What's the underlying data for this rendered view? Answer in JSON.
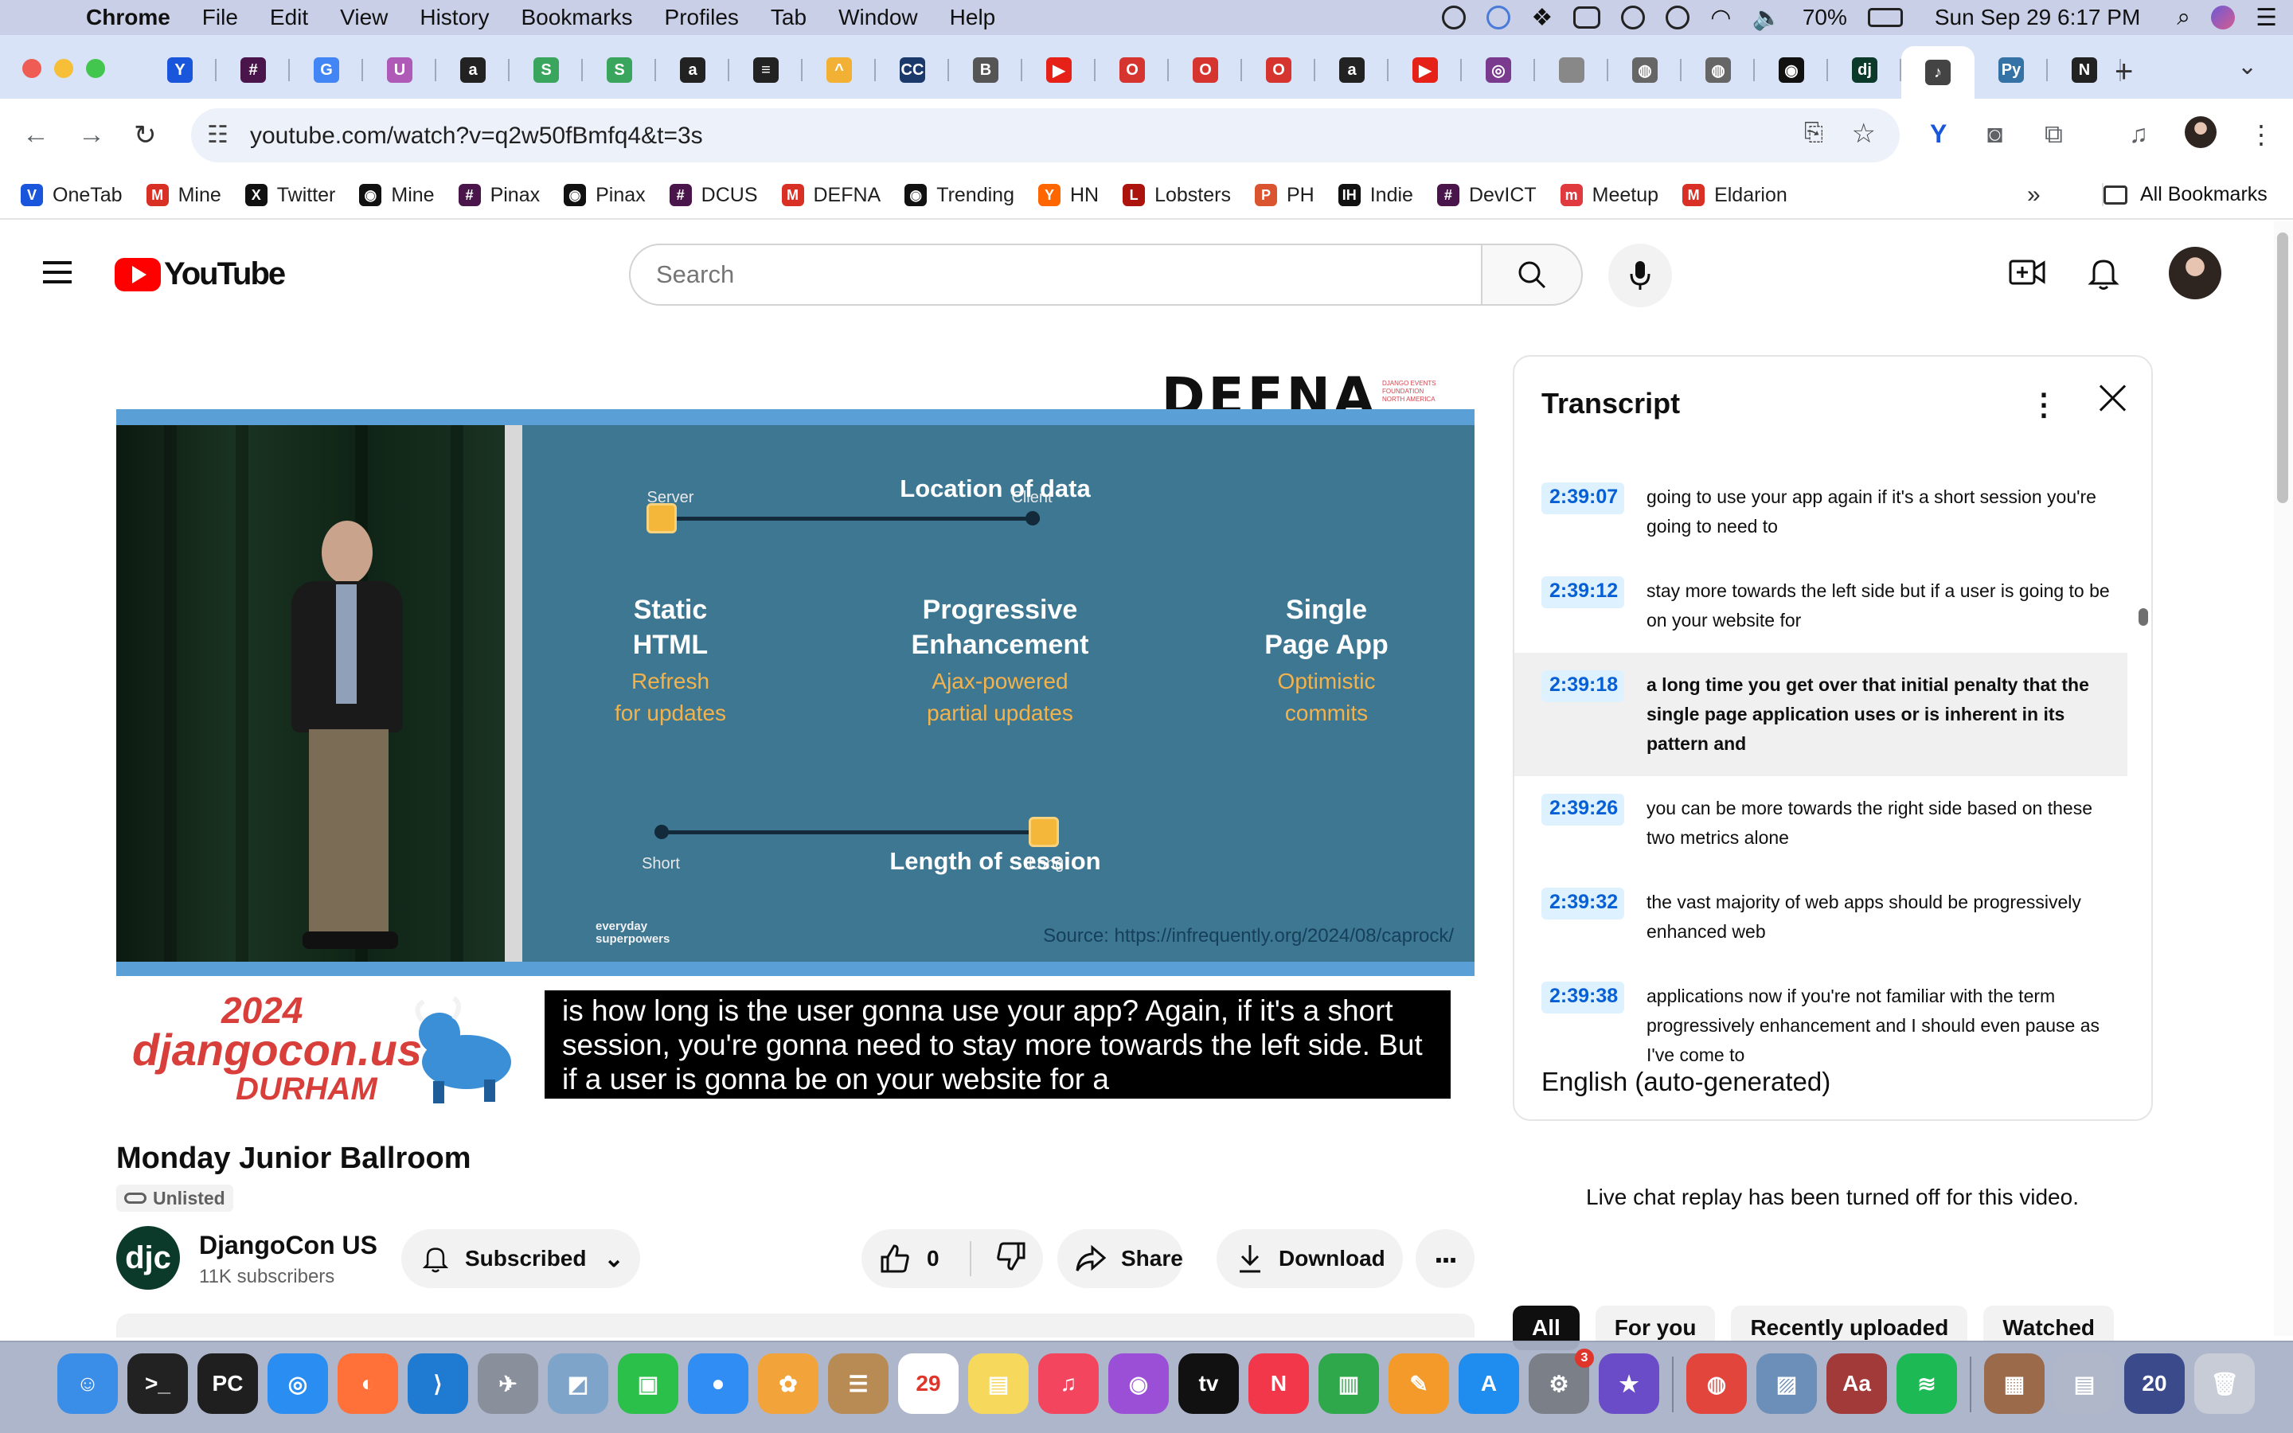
{
  "menubar": {
    "app": "Chrome",
    "items": [
      "File",
      "Edit",
      "View",
      "History",
      "Bookmarks",
      "Profiles",
      "Tab",
      "Window",
      "Help"
    ],
    "battery": "70%",
    "datetime": "Sun Sep 29  6:17 PM"
  },
  "tabs": [
    {
      "icon": "vee-icon",
      "glyph": "Y",
      "color": "#1a56db"
    },
    {
      "icon": "slack-icon",
      "glyph": "#",
      "color": "#4a154b"
    },
    {
      "icon": "google-icon",
      "glyph": "G",
      "color": "#4285f4"
    },
    {
      "icon": "unicorn-icon",
      "glyph": "U",
      "color": "#b05ab7"
    },
    {
      "icon": "amazon-icon",
      "glyph": "a",
      "color": "#222222"
    },
    {
      "icon": "sheets-icon",
      "glyph": "S",
      "color": "#3aa55c"
    },
    {
      "icon": "sheets-icon",
      "glyph": "S",
      "color": "#3aa55c"
    },
    {
      "icon": "amazon-icon",
      "glyph": "a",
      "color": "#222222"
    },
    {
      "icon": "stack-icon",
      "glyph": "≡",
      "color": "#222222"
    },
    {
      "icon": "sketch-icon",
      "glyph": "^",
      "color": "#f2b035"
    },
    {
      "icon": "cc-icon",
      "glyph": "CC",
      "color": "#1b3a6b"
    },
    {
      "icon": "book-icon",
      "glyph": "B",
      "color": "#555555"
    },
    {
      "icon": "youtube-icon",
      "glyph": "▶",
      "color": "#e62117"
    },
    {
      "icon": "opera-icon",
      "glyph": "O",
      "color": "#d6342f"
    },
    {
      "icon": "opera-icon",
      "glyph": "O",
      "color": "#d6342f"
    },
    {
      "icon": "opera-icon",
      "glyph": "O",
      "color": "#d6342f"
    },
    {
      "icon": "amazon-icon",
      "glyph": "a",
      "color": "#222222"
    },
    {
      "icon": "youtube-icon",
      "glyph": "▶",
      "color": "#e62117"
    },
    {
      "icon": "circle-icon",
      "glyph": "◎",
      "color": "#7a3b8f"
    },
    {
      "icon": "apple-icon",
      "glyph": "",
      "color": "#888888"
    },
    {
      "icon": "globe-icon",
      "glyph": "◍",
      "color": "#666666"
    },
    {
      "icon": "globe-icon",
      "glyph": "◍",
      "color": "#666666"
    },
    {
      "icon": "github-icon",
      "glyph": "◉",
      "color": "#111111"
    },
    {
      "icon": "django-icon",
      "glyph": "dj",
      "color": "#0c3a2a"
    },
    {
      "icon": "speaker-icon",
      "glyph": "♪",
      "color": "#444444",
      "active": true
    },
    {
      "icon": "python-icon",
      "glyph": "Py",
      "color": "#3572a5"
    },
    {
      "icon": "dark-icon",
      "glyph": "N",
      "color": "#222222"
    }
  ],
  "toolbar": {
    "url": "youtube.com/watch?v=q2w50fBmfq4&t=3s"
  },
  "bookmarks": [
    {
      "label": "OneTab",
      "icon": "onetab-icon",
      "glyph": "V",
      "color": "#1a56db"
    },
    {
      "label": "Mine",
      "icon": "gmail-icon",
      "glyph": "M",
      "color": "#d93025"
    },
    {
      "label": "Twitter",
      "icon": "x-icon",
      "glyph": "X",
      "color": "#111111"
    },
    {
      "label": "Mine",
      "icon": "github-icon",
      "glyph": "◉",
      "color": "#111111"
    },
    {
      "label": "Pinax",
      "icon": "slack-icon",
      "glyph": "#",
      "color": "#4a154b"
    },
    {
      "label": "Pinax",
      "icon": "github-icon",
      "glyph": "◉",
      "color": "#111111"
    },
    {
      "label": "DCUS",
      "icon": "slack-icon",
      "glyph": "#",
      "color": "#4a154b"
    },
    {
      "label": "DEFNA",
      "icon": "gmail-icon",
      "glyph": "M",
      "color": "#d93025"
    },
    {
      "label": "Trending",
      "icon": "github-icon",
      "glyph": "◉",
      "color": "#111111"
    },
    {
      "label": "HN",
      "icon": "hn-icon",
      "glyph": "Y",
      "color": "#ff6600"
    },
    {
      "label": "Lobsters",
      "icon": "lobsters-icon",
      "glyph": "L",
      "color": "#ac130d"
    },
    {
      "label": "PH",
      "icon": "producthunt-icon",
      "glyph": "P",
      "color": "#da552f"
    },
    {
      "label": "Indie",
      "icon": "indie-icon",
      "glyph": "IH",
      "color": "#111111"
    },
    {
      "label": "DevICT",
      "icon": "slack-icon",
      "glyph": "#",
      "color": "#4a154b"
    },
    {
      "label": "Meetup",
      "icon": "meetup-icon",
      "glyph": "m",
      "color": "#e0393e"
    },
    {
      "label": "Eldarion",
      "icon": "gmail-icon",
      "glyph": "M",
      "color": "#d93025"
    }
  ],
  "bookmarks_more": "»",
  "all_bookmarks": "All Bookmarks",
  "youtube": {
    "logo_text": "YouTube",
    "search_placeholder": "Search"
  },
  "video": {
    "watermark": "DEFNA",
    "watermark_tag": "DJANGO EVENTS FOUNDATION NORTH AMERICA",
    "slide": {
      "top_axis": "Location of data",
      "top_left": "Server",
      "top_right": "Client",
      "col1_title": "Static\nHTML",
      "col1_sub": "Refresh\nfor updates",
      "col2_title": "Progressive\nEnhancement",
      "col2_sub": "Ajax-powered\npartial updates",
      "col3_title": "Single\nPage App",
      "col3_sub": "Optimistic\ncommits",
      "bottom_axis": "Length of session",
      "bottom_left": "Short",
      "bottom_right": "Long",
      "brand": "everyday\nsuperpowers",
      "source": "Source: https://infrequently.org/2024/08/caprock/"
    },
    "banner_year": "2024",
    "banner_name": "djangocon.us",
    "banner_city": "DURHAM",
    "caption": "is how long is the user gonna use your app? Again, if it's a short session, you're gonna need to stay more towards the left side. But if a user is gonna be on your website for a"
  },
  "meta": {
    "title": "Monday Junior Ballroom",
    "visibility": "Unlisted",
    "channel_name": "DjangoCon US",
    "channel_avatar_text": "djc",
    "subscribers": "11K subscribers",
    "subscribed_label": "Subscribed",
    "like_count": "0",
    "share_label": "Share",
    "download_label": "Download"
  },
  "transcript": {
    "title": "Transcript",
    "language": "English (auto-generated)",
    "segments": [
      {
        "time": "2:39:07",
        "text": "going to use your app again if it's a short session you're going to need to"
      },
      {
        "time": "2:39:12",
        "text": "stay more towards the left side but if a user is going to be on your website for"
      },
      {
        "time": "2:39:18",
        "text": "a long time you get over that initial penalty that the single page application uses or is inherent in its pattern and",
        "active": true
      },
      {
        "time": "2:39:26",
        "text": "you can be more towards the right side based on these two metrics alone"
      },
      {
        "time": "2:39:32",
        "text": "the vast majority of web apps should be progressively enhanced web"
      },
      {
        "time": "2:39:38",
        "text": "applications now if you're not familiar with the term progressively enhancement and I should even pause as I've come to"
      }
    ]
  },
  "live_chat_note": "Live chat replay has been turned off for this video.",
  "chips": [
    "All",
    "For you",
    "Recently uploaded",
    "Watched"
  ],
  "dock": [
    {
      "icon": "finder-icon",
      "glyph": "☺",
      "color": "#3b8ee8"
    },
    {
      "icon": "terminal-icon",
      "glyph": ">_",
      "color": "#222222"
    },
    {
      "icon": "pycharm-icon",
      "glyph": "PC",
      "color": "#1f1f1f"
    },
    {
      "icon": "safari-icon",
      "glyph": "◎",
      "color": "#2a8df2"
    },
    {
      "icon": "firefox-icon",
      "glyph": "◐",
      "color": "#ff7139"
    },
    {
      "icon": "vscode-icon",
      "glyph": "⟩",
      "color": "#1f7ad1"
    },
    {
      "icon": "launchpad-icon",
      "glyph": "✈",
      "color": "#8a8f9c"
    },
    {
      "icon": "preview-icon",
      "glyph": "◩",
      "color": "#7fa4c9"
    },
    {
      "icon": "facetime-icon",
      "glyph": "▣",
      "color": "#2bc04a"
    },
    {
      "icon": "messages-icon",
      "glyph": "●",
      "color": "#2f8df3"
    },
    {
      "icon": "photos-icon",
      "glyph": "✿",
      "color": "#f2a33a"
    },
    {
      "icon": "contacts-icon",
      "glyph": "☰",
      "color": "#b88a54"
    },
    {
      "icon": "calendar-icon",
      "glyph": "29",
      "color": "#ffffff"
    },
    {
      "icon": "notes-icon",
      "glyph": "▤",
      "color": "#f6d95c"
    },
    {
      "icon": "music-icon",
      "glyph": "♫",
      "color": "#f3455d"
    },
    {
      "icon": "podcasts-icon",
      "glyph": "◉",
      "color": "#9b4fd6"
    },
    {
      "icon": "tv-icon",
      "glyph": "tv",
      "color": "#111111"
    },
    {
      "icon": "news-icon",
      "glyph": "N",
      "color": "#f2374a"
    },
    {
      "icon": "numbers-icon",
      "glyph": "▥",
      "color": "#2ea84a"
    },
    {
      "icon": "pages-icon",
      "glyph": "✎",
      "color": "#f39a2b"
    },
    {
      "icon": "appstore-icon",
      "glyph": "A",
      "color": "#1f8cf0"
    },
    {
      "icon": "settings-icon",
      "glyph": "⚙",
      "color": "#7b7f88",
      "badge": "3"
    },
    {
      "icon": "imovie-icon",
      "glyph": "★",
      "color": "#6a4cc9"
    },
    {
      "icon": "chrome-icon",
      "glyph": "◍",
      "color": "#e2453b"
    },
    {
      "icon": "preview-icon",
      "glyph": "▨",
      "color": "#6b8fb8"
    },
    {
      "icon": "dictionary-icon",
      "glyph": "Aa",
      "color": "#a33a3a"
    },
    {
      "icon": "spotify-icon",
      "glyph": "≋",
      "color": "#1db954"
    },
    {
      "icon": "photo-stack-icon",
      "glyph": "▦",
      "color": "#9a6a4b"
    },
    {
      "icon": "screenshot-icon",
      "glyph": "▤",
      "color": "#b0b7c8"
    },
    {
      "icon": "screenshot-icon",
      "glyph": "20",
      "color": "#3a4a8a"
    },
    {
      "icon": "trash-icon",
      "glyph": "🗑",
      "color": "#c7ccd6"
    }
  ]
}
